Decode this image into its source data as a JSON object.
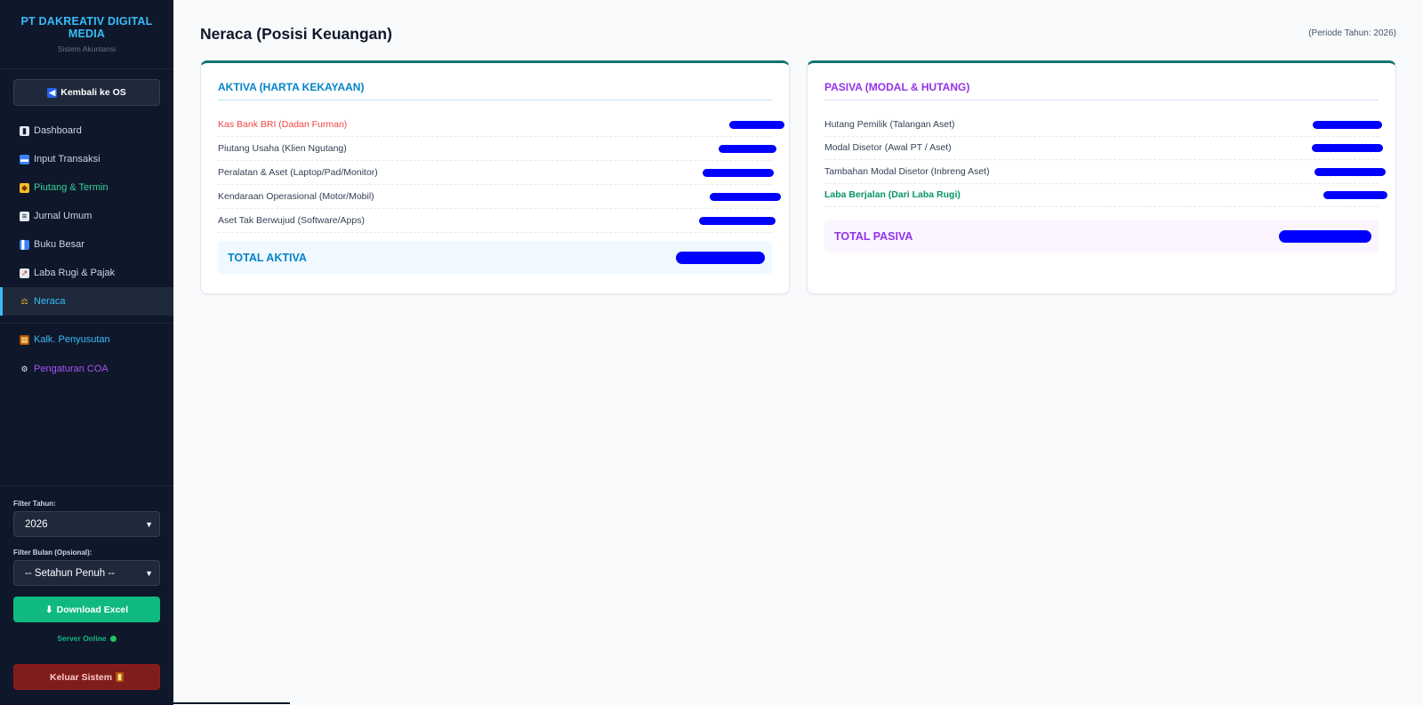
{
  "sidebar": {
    "brand_name": "PT DAKREATIV DIGITAL MEDIA",
    "brand_sub": "Sistem Akuntansi",
    "back_label": "Kembali ke OS",
    "items": [
      {
        "label": "Dashboard",
        "icon": "bar-chart-icon",
        "color": "#cbd5e1"
      },
      {
        "label": "Input Transaksi",
        "icon": "card-icon",
        "color": "#cbd5e1"
      },
      {
        "label": "Piutang & Termin",
        "icon": "tag-icon",
        "color": "#34d399"
      },
      {
        "label": "Jurnal Umum",
        "icon": "ledger-icon",
        "color": "#cbd5e1"
      },
      {
        "label": "Buku Besar",
        "icon": "book-icon",
        "color": "#cbd5e1"
      },
      {
        "label": "Laba Rugi & Pajak",
        "icon": "trend-icon",
        "color": "#cbd5e1"
      },
      {
        "label": "Neraca",
        "icon": "scale-icon",
        "color": "#38bdf8",
        "active": true
      }
    ],
    "tools": [
      {
        "label": "Kalk. Penyusutan",
        "icon": "abacus-icon",
        "color": "#38bdf8"
      },
      {
        "label": "Pengaturan COA",
        "icon": "gear-icon",
        "color": "#a855f7"
      }
    ],
    "filter_year_label": "Filter Tahun:",
    "filter_year_value": "2026",
    "filter_month_label": "Filter Bulan (Opsional):",
    "filter_month_value": "-- Setahun Penuh --",
    "download_label": "Download Excel",
    "server_status": "Server Online",
    "logout_label": "Keluar Sistem"
  },
  "main": {
    "title": "Neraca (Posisi Keuangan)",
    "period": "(Periode Tahun: 2026)"
  },
  "aktiva": {
    "title": "AKTIVA (HARTA KEKAYAAN)",
    "rows": [
      {
        "label": "Kas Bank BRI (Dadan Furman)",
        "style": "red"
      },
      {
        "label": "Piutang Usaha (Klien Ngutang)",
        "style": ""
      },
      {
        "label": "Peralatan & Aset (Laptop/Pad/Monitor)",
        "style": ""
      },
      {
        "label": "Kendaraan Operasional (Motor/Mobil)",
        "style": ""
      },
      {
        "label": "Aset Tak Berwujud (Software/Apps)",
        "style": ""
      }
    ],
    "total_label": "TOTAL AKTIVA"
  },
  "pasiva": {
    "title": "PASIVA (MODAL & HUTANG)",
    "rows": [
      {
        "label": "Hutang Pemilik (Talangan Aset)",
        "style": ""
      },
      {
        "label": "Modal Disetor (Awal PT / Aset)",
        "style": ""
      },
      {
        "label": "Tambahan Modal Disetor (Inbreng Aset)",
        "style": ""
      },
      {
        "label": "Laba Berjalan (Dari Laba Rugi)",
        "style": "green"
      }
    ],
    "total_label": "TOTAL PASIVA"
  }
}
